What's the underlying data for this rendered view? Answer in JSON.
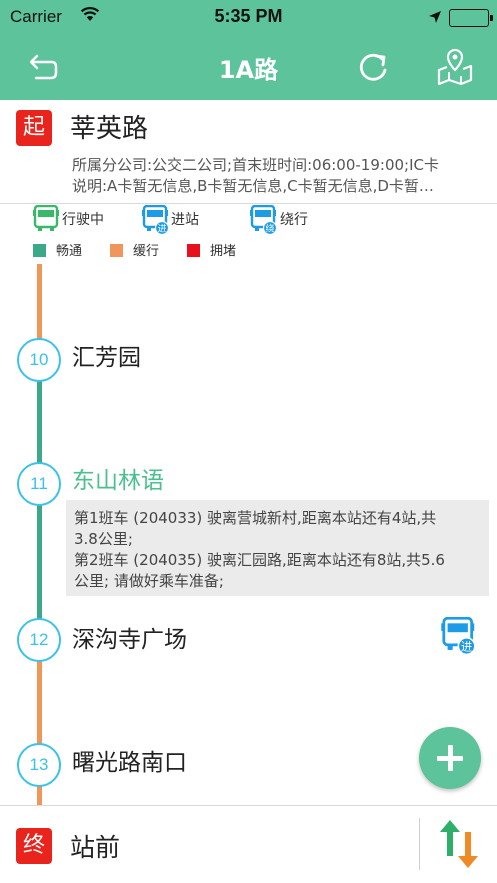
{
  "status_bar": {
    "carrier": "Carrier",
    "time": "5:35 PM"
  },
  "nav": {
    "title": "1A路"
  },
  "start": {
    "badge": "起",
    "name": "莘英路",
    "info_line1": "所属分公司:公交二公司;首末班时间:06:00-19:00;IC卡",
    "info_line2": "说明:A卡暂无信息,B卡暂无信息,C卡暂无信息,D卡暂…"
  },
  "legend": {
    "bus_states": [
      "行驶中",
      "进站",
      "绕行"
    ],
    "traffic": [
      {
        "label": "畅通",
        "color": "#3aa889"
      },
      {
        "label": "缓行",
        "color": "#f0965a"
      },
      {
        "label": "拥堵",
        "color": "#e8101a"
      }
    ]
  },
  "stops": [
    {
      "number": "10",
      "name": "汇芳园"
    },
    {
      "number": "11",
      "name": "东山林语"
    },
    {
      "number": "12",
      "name": "深沟寺广场"
    },
    {
      "number": "13",
      "name": "曙光路南口"
    }
  ],
  "arrival_info": {
    "line1": "第1班车 (204033) 驶离营城新村,距离本站还有4站,共",
    "line2": "3.8公里;",
    "line3": "第2班车 (204035) 驶离汇园路,距离本站还有8站,共5.6",
    "line4": "公里;  请做好乘车准备;"
  },
  "end": {
    "badge": "终",
    "name": "站前"
  },
  "colors": {
    "brand": "#5cc39b",
    "stop_ring": "#3bc2e8",
    "bus_icon_blue": "#1e9be6",
    "bus_icon_green": "#3ab86a"
  }
}
